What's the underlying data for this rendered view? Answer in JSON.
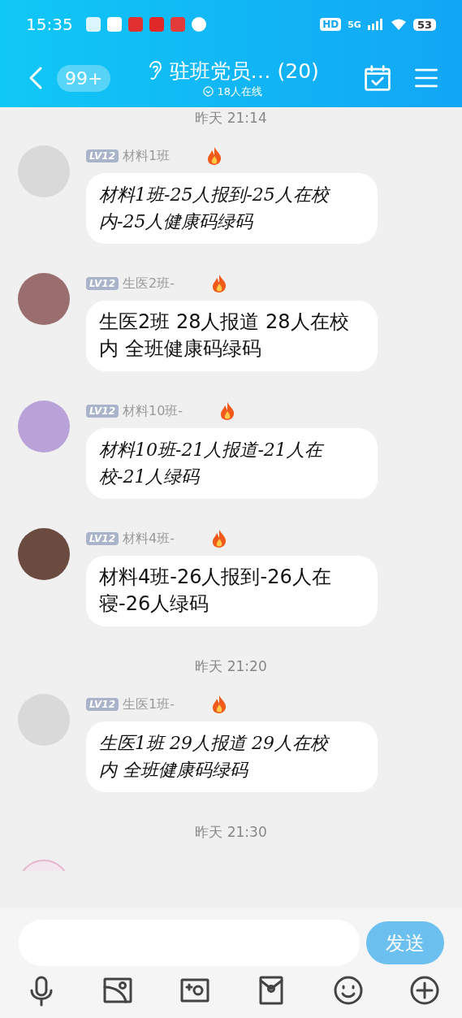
{
  "status_bar": {
    "time": "15:35",
    "hd": "HD",
    "network": "5G",
    "battery": "53"
  },
  "header": {
    "unread": "99+",
    "title": "驻班党员… (20)",
    "subtitle": "18人在线"
  },
  "chat": [
    {
      "kind": "time",
      "text": "昨天 21:14"
    },
    {
      "kind": "handwritten_message",
      "level": "LV12",
      "name": "材料1班",
      "text": "材料1班-25人报到-25人在校内-25人健康码绿码"
    },
    {
      "kind": "message",
      "level": "LV12",
      "name": "生医2班-",
      "text": "生医2班 28人报道 28人在校内 全班健康码绿码"
    },
    {
      "kind": "handwritten_message",
      "level": "LV12",
      "name": "材料10班-",
      "text": "材料10班-21人报道-21人在校-21人绿码"
    },
    {
      "kind": "message",
      "level": "LV12",
      "name": "材料4班-",
      "text": "材料4班-26人报到-26人在寝-26人绿码"
    },
    {
      "kind": "time",
      "text": "昨天 21:20"
    },
    {
      "kind": "handwritten_message",
      "level": "LV12",
      "name": "生医1班-",
      "text": "生医1班 29人报道 29人在校内 全班健康码绿码"
    },
    {
      "kind": "time",
      "text": "昨天 21:30"
    },
    {
      "kind": "partial"
    }
  ],
  "composer": {
    "send": "发送"
  }
}
